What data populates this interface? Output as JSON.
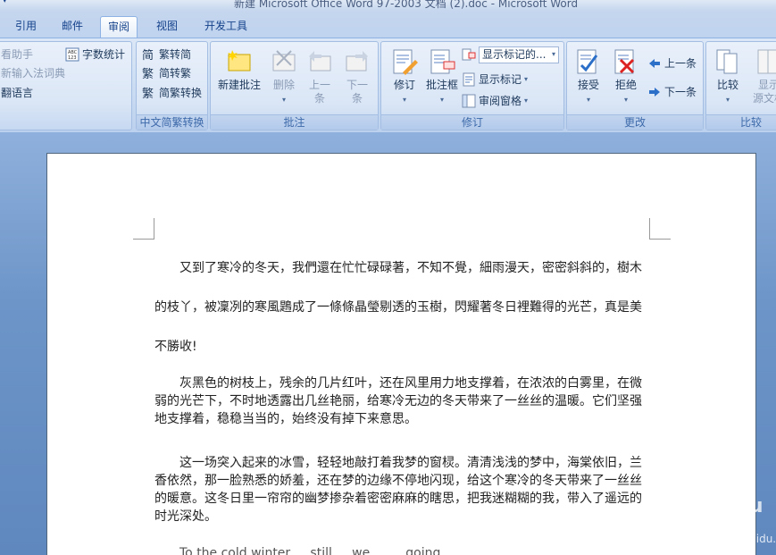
{
  "window": {
    "title": "新建 Microsoft Office Word 97-2003 文档 (2).doc - Microsoft Word"
  },
  "tabs": [
    {
      "label": "引用"
    },
    {
      "label": "邮件"
    },
    {
      "label": "审阅",
      "active": true
    },
    {
      "label": "视图"
    },
    {
      "label": "开发工具"
    }
  ],
  "ribbon": {
    "proofing": {
      "items": [
        "看助手",
        "新输入法词典",
        "翻语言"
      ],
      "word_count": "字数统计"
    },
    "chinese_conversion": {
      "label": "中文简繁转换",
      "to_simplified": "繁转简",
      "to_traditional": "简转繁",
      "convert": "简繁转换"
    },
    "comments": {
      "label": "批注",
      "new_comment": "新建批注",
      "delete": "删除",
      "previous": [
        "上一",
        "条"
      ],
      "next": [
        "下一",
        "条"
      ]
    },
    "tracking": {
      "label": "修订",
      "track_changes": "修订",
      "balloons": "批注框",
      "display_select": "显示标记的...",
      "show_markup": "显示标记",
      "reviewing_pane": "审阅窗格"
    },
    "changes": {
      "label": "更改",
      "accept": "接受",
      "reject": "拒绝",
      "previous": "上一条",
      "next": "下一条"
    },
    "compare": {
      "label": "比较",
      "compare": "比较",
      "show_source": [
        "显示",
        "源文档"
      ]
    }
  },
  "document": {
    "paragraphs": [
      "又到了寒冷的冬天，我們還在忙忙碌碌著，不知不覺，細雨漫天，密密斜斜的，樹木的枝丫，被凜冽的寒風鶗成了一條條晶瑩剔透的玉樹，閃耀著冬日裡難得的光芒，真是美不勝收!",
      "灰黑色的树枝上，残余的几片红叶，还在风里用力地支撑着，在浓浓的白雾里，在微弱的光芒下，不时地透露出几丝艳丽，给寒冷无边的冬天带来了一丝丝的温暖。它们坚强地支撑着，稳稳当当的，始终没有掉下来意思。",
      "这一场突入起来的冰雪，轻轻地敲打着我梦的窗棂。清清浅浅的梦中，海棠依旧，兰香依然，那一脸熟悉的娇羞，还在梦的边缘不停地闪现，给这个寒冷的冬天带来了一丝丝的暖意。这冬日里一帘帘的幽梦掺杂着密密麻麻的瞎思，把我迷糊糊的我，带入了遥远的时光深处。",
      "To the cold winter ... still ... we ... ... going ... ..."
    ]
  },
  "watermark": {
    "text": "Baidu 经验",
    "url": "jingyan.baidu.com"
  }
}
